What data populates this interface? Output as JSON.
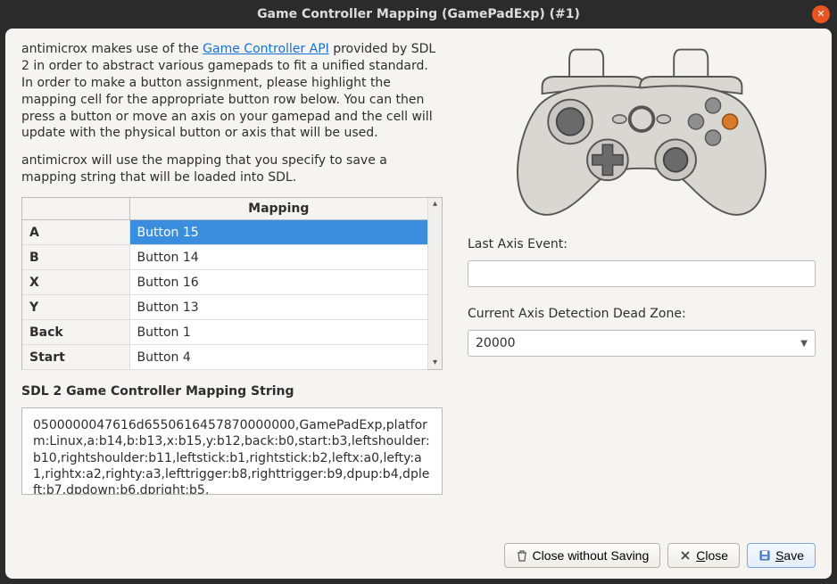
{
  "window": {
    "title": "Game Controller Mapping (GamePadExp) (#1)"
  },
  "description": {
    "pre": "antimicrox makes use of the ",
    "link": "Game Controller API",
    "post": " provided by SDL 2 in order to abstract various gamepads to fit a unified standard. In order to make a button assignment, please highlight the mapping cell for the appropriate button row below. You can then press a button or move an axis on your gamepad and the cell will update with the physical button or axis that will be used.",
    "para2": "antimicrox will use the mapping that you specify to save a mapping string that will be loaded into SDL."
  },
  "table": {
    "header": "Mapping",
    "rows": [
      {
        "name": "A",
        "val": "Button 15",
        "selected": true
      },
      {
        "name": "B",
        "val": "Button 14",
        "selected": false
      },
      {
        "name": "X",
        "val": "Button 16",
        "selected": false
      },
      {
        "name": "Y",
        "val": "Button 13",
        "selected": false
      },
      {
        "name": "Back",
        "val": "Button 1",
        "selected": false
      },
      {
        "name": "Start",
        "val": "Button 4",
        "selected": false
      }
    ]
  },
  "sdl": {
    "label": "SDL 2 Game Controller Mapping String",
    "value": "0500000047616d6550616457870000000,GamePadExp,platform:Linux,a:b14,b:b13,x:b15,y:b12,back:b0,start:b3,leftshoulder:b10,rightshoulder:b11,leftstick:b1,rightstick:b2,leftx:a0,lefty:a1,rightx:a2,righty:a3,lefttrigger:b8,righttrigger:b9,dpup:b4,dpleft:b7,dpdown:b6,dpright:b5,"
  },
  "right": {
    "last_axis_label": "Last Axis Event:",
    "last_axis_value": "",
    "deadzone_label": "Current Axis Detection Dead Zone:",
    "deadzone_value": "20000"
  },
  "buttons": {
    "close_no_save": "Close without Saving",
    "close": "Close",
    "save": "Save"
  }
}
